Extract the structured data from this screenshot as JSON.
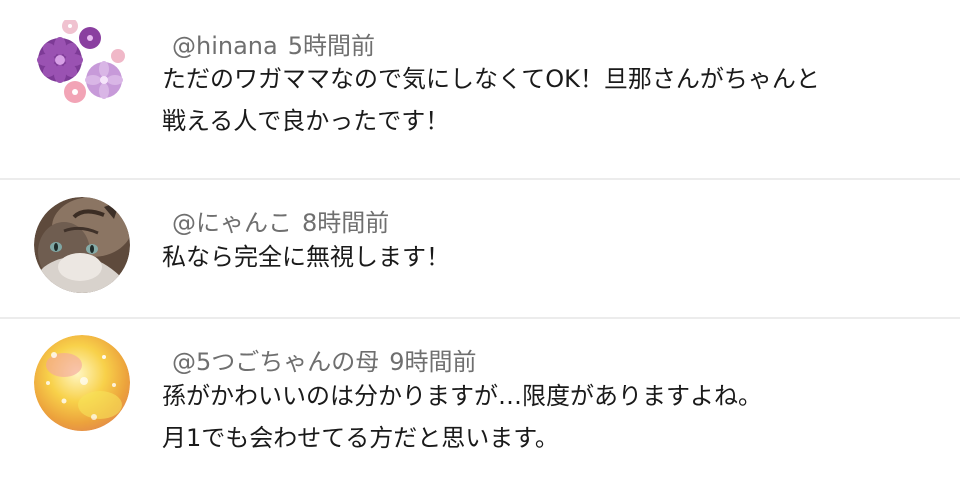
{
  "comments": [
    {
      "username": "@hinana",
      "time": "5時間前",
      "lines": [
        "ただのワガママなので気にしなくてOK！旦那さんがちゃんと",
        "戦える人で良かったです！"
      ]
    },
    {
      "username": "@にゃんこ",
      "time": "8時間前",
      "lines": [
        "私なら完全に無視します！"
      ]
    },
    {
      "username": "@5つごちゃんの母",
      "time": "9時間前",
      "lines": [
        "孫がかわいいのは分かりますが…限度がありますよね。",
        "月1でも会わせてる方だと思います。"
      ]
    }
  ],
  "colors": {
    "divider": "#ececec",
    "meta_text": "#6f6f6f",
    "body_text": "#1a1a1a"
  }
}
